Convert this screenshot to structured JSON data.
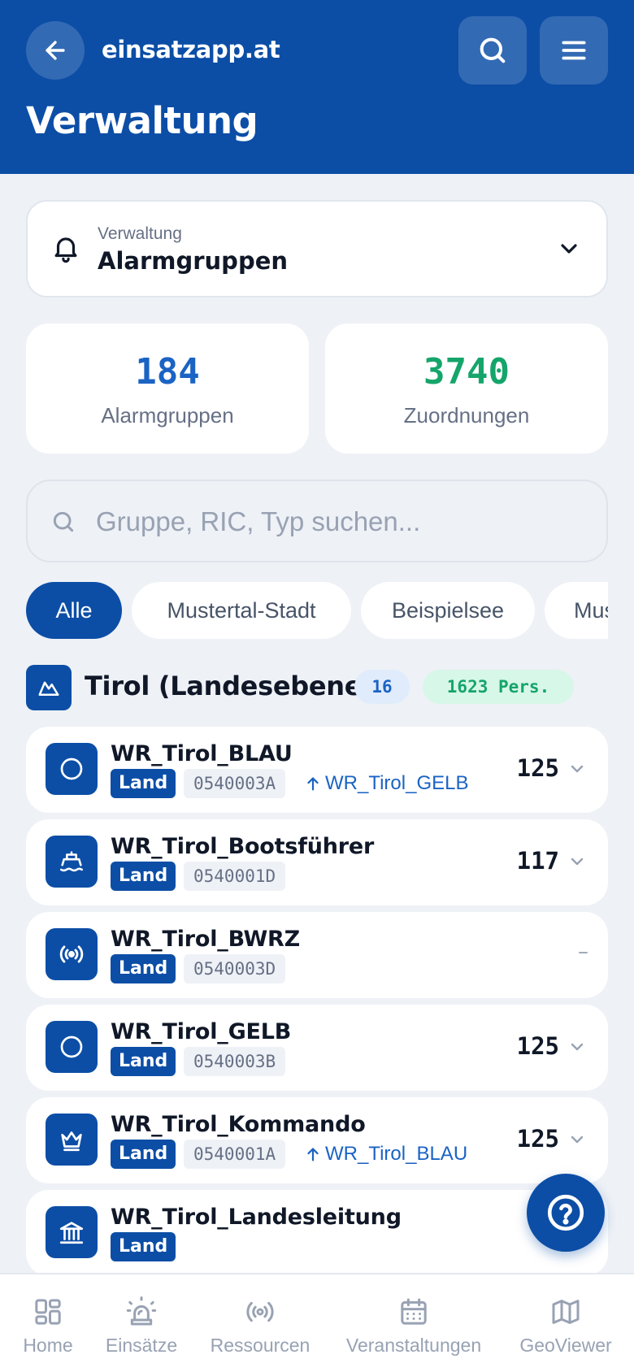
{
  "header": {
    "app_name": "einsatzapp.at",
    "page_title": "Verwaltung"
  },
  "selector": {
    "caption": "Verwaltung",
    "value": "Alarmgruppen"
  },
  "stats": [
    {
      "value": "184",
      "label": "Alarmgruppen",
      "color": "#1b63c4"
    },
    {
      "value": "3740",
      "label": "Zuordnungen",
      "color": "#15a56b"
    }
  ],
  "search": {
    "placeholder": "Gruppe, RIC, Typ suchen..."
  },
  "filters": [
    "Alle",
    "Mustertal-Stadt",
    "Beispielsee",
    "Mus"
  ],
  "section": {
    "title": "Tirol (Landesebene)",
    "count": "16",
    "persons": "1623 Pers."
  },
  "groups": [
    {
      "name": "WR_Tirol_BLAU",
      "badge": "Land",
      "code": "0540003A",
      "parent": "WR_Tirol_GELB",
      "count": "125",
      "icon": "circle-icon"
    },
    {
      "name": "WR_Tirol_Bootsführer",
      "badge": "Land",
      "code": "0540001D",
      "parent": "",
      "count": "117",
      "icon": "boat-icon"
    },
    {
      "name": "WR_Tirol_BWRZ",
      "badge": "Land",
      "code": "0540003D",
      "parent": "",
      "count": "–",
      "icon": "radio-icon"
    },
    {
      "name": "WR_Tirol_GELB",
      "badge": "Land",
      "code": "0540003B",
      "parent": "",
      "count": "125",
      "icon": "circle-icon"
    },
    {
      "name": "WR_Tirol_Kommando",
      "badge": "Land",
      "code": "0540001A",
      "parent": "WR_Tirol_BLAU",
      "count": "125",
      "icon": "crown-icon"
    },
    {
      "name": "WR_Tirol_Landesleitung",
      "badge": "Land",
      "code": "",
      "parent": "",
      "count": "",
      "icon": "building-icon"
    }
  ],
  "bottom_nav": [
    {
      "label": "Home",
      "icon": "grid-icon"
    },
    {
      "label": "Einsätze",
      "icon": "siren-icon"
    },
    {
      "label": "Ressourcen",
      "icon": "radio-icon"
    },
    {
      "label": "Veranstaltungen",
      "icon": "calendar-icon"
    },
    {
      "label": "GeoViewer",
      "icon": "map-icon"
    }
  ],
  "colors": {
    "primary": "#0c4ea6",
    "accent_blue": "#1b63c4",
    "accent_green": "#15a56b",
    "background": "#eef1f6"
  }
}
